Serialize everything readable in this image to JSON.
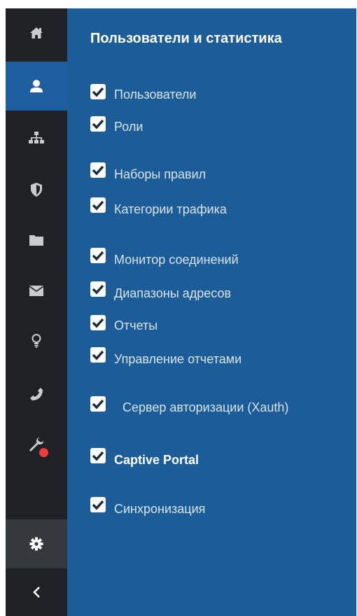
{
  "nav": {
    "items": [
      {
        "name": "home-icon",
        "active": false
      },
      {
        "name": "user-icon",
        "active": true
      },
      {
        "name": "sitemap-icon",
        "active": false
      },
      {
        "name": "shield-icon",
        "active": false
      },
      {
        "name": "folder-icon",
        "active": false
      },
      {
        "name": "envelope-icon",
        "active": false
      },
      {
        "name": "lightbulb-icon",
        "active": false
      },
      {
        "name": "phone-icon",
        "active": false
      },
      {
        "name": "wrench-icon",
        "active": false,
        "badge": true
      }
    ],
    "settings_icon": "gear-icon",
    "collapse_icon": "chevron-left-icon",
    "accent_color": "#1e5fa0",
    "badge_color": "#ee3b3b"
  },
  "panel": {
    "title": "Пользователи и статистика",
    "background_color": "#1c5d99",
    "permissions": [
      {
        "label": "Пользователи",
        "checked": true
      },
      {
        "label": "Роли",
        "checked": true
      },
      {
        "label": "Наборы правил",
        "checked": true
      },
      {
        "label": "Категории трафика",
        "checked": true
      },
      {
        "label": "Монитор соединений",
        "checked": true
      },
      {
        "label": "Диапазоны адресов",
        "checked": true
      },
      {
        "label": "Отчеты",
        "checked": true
      },
      {
        "label": "Управление отчетами",
        "checked": true
      },
      {
        "label": "Сервер авторизации (Xauth)",
        "checked": true
      },
      {
        "label": "Captive Portal",
        "checked": true
      },
      {
        "label": "Синхронизация",
        "checked": true
      }
    ]
  }
}
